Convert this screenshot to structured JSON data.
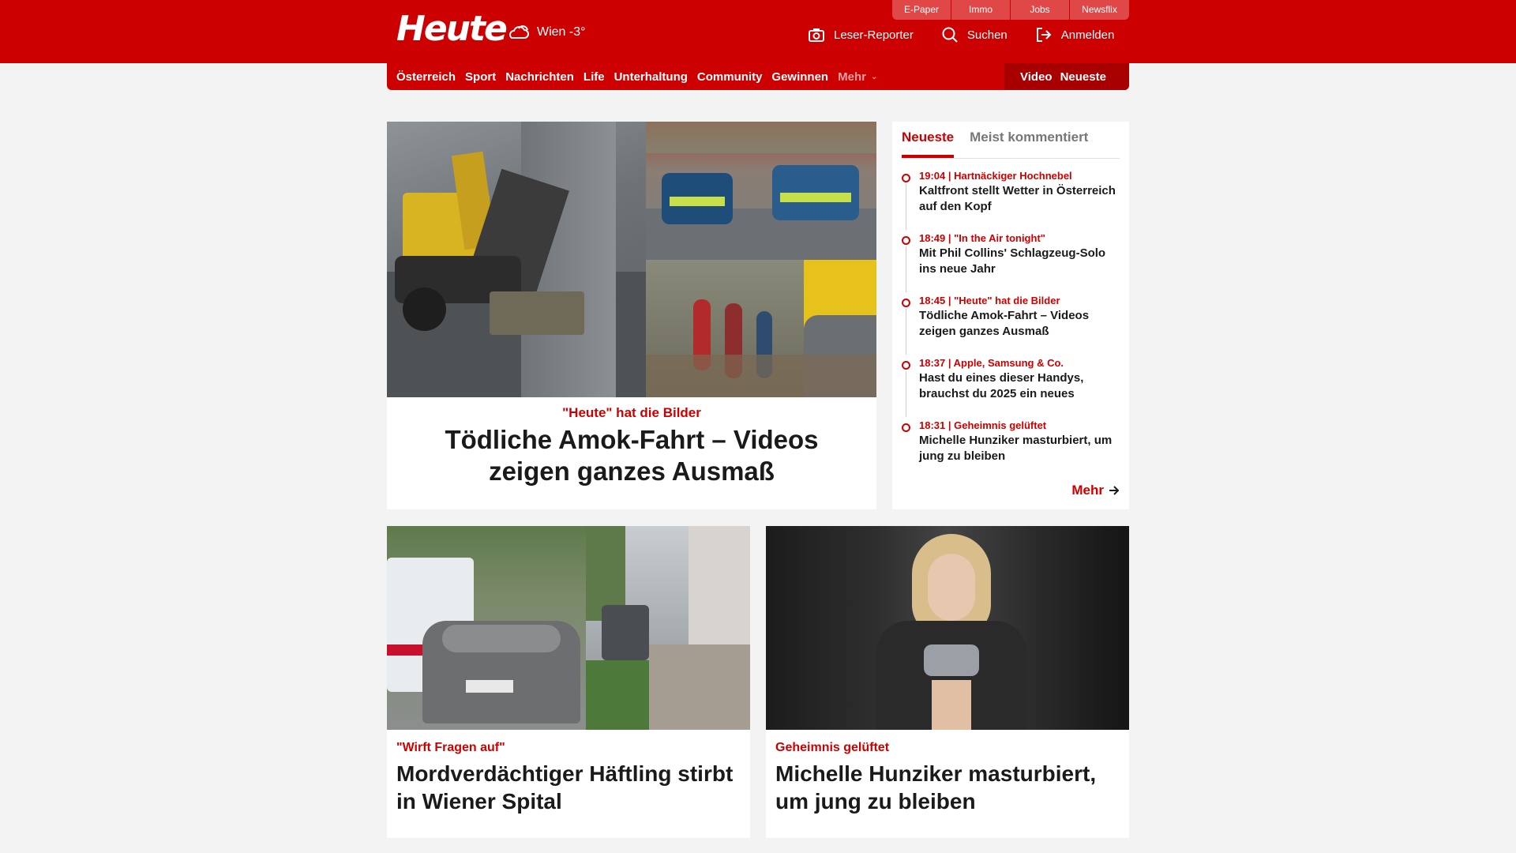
{
  "header": {
    "logo": "Heute",
    "weather": "Wien -3°",
    "toplinks": [
      "E-Paper",
      "Immo",
      "Jobs",
      "Newsflix"
    ],
    "actions": {
      "reporter": "Leser-Reporter",
      "search": "Suchen",
      "login": "Anmelden"
    }
  },
  "nav": {
    "items": [
      "Österreich",
      "Sport",
      "Nachrichten",
      "Life",
      "Unterhaltung",
      "Community",
      "Gewinnen"
    ],
    "more": "Mehr",
    "right": [
      "Video",
      "Neueste"
    ]
  },
  "hero": {
    "kicker": "\"Heute\" hat die Bilder",
    "title": "Tödliche Amok-Fahrt – Videos zeigen ganzes Ausmaß"
  },
  "sidebar": {
    "tabs": [
      "Neueste",
      "Meist kommentiert"
    ],
    "items": [
      {
        "meta": "19:04 | Hartnäckiger Hochnebel",
        "text": "Kaltfront stellt Wetter in Österreich auf den Kopf"
      },
      {
        "meta": "18:49 | \"In the Air tonight\"",
        "text": "Mit Phil Collins' Schlagzeug-Solo ins neue Jahr"
      },
      {
        "meta": "18:45 | \"Heute\" hat die Bilder",
        "text": "Tödliche Amok-Fahrt – Videos zeigen ganzes Ausmaß"
      },
      {
        "meta": "18:37 | Apple, Samsung & Co.",
        "text": "Hast du eines dieser Handys, brauchst du 2025 ein neues"
      },
      {
        "meta": "18:31 | Geheimnis gelüftet",
        "text": "Michelle Hunziker masturbiert, um jung zu bleiben"
      }
    ],
    "more": "Mehr"
  },
  "cards": [
    {
      "kicker": "\"Wirft Fragen auf\"",
      "title": "Mordverdächtiger Häftling stirbt in Wiener Spital"
    },
    {
      "kicker": "Geheimnis gelüftet",
      "title": "Michelle Hunziker masturbiert, um jung zu bleiben"
    }
  ],
  "colors": {
    "brand": "#cc0000",
    "background": "#f3f3f3"
  }
}
